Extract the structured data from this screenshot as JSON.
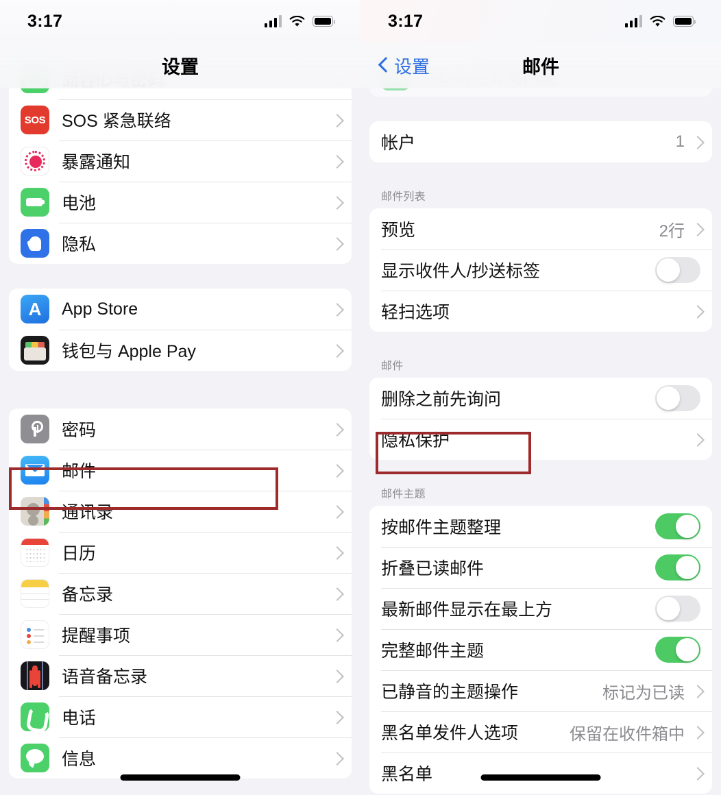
{
  "status_bar": {
    "time": "3:17",
    "cellular_icon": "signal-bars-icon",
    "wifi_icon": "wifi-icon",
    "battery_icon": "battery-full-icon"
  },
  "left_pane": {
    "nav": {
      "title": "设置"
    },
    "groups": [
      {
        "label": "",
        "rows": [
          {
            "label": "面容ID与密码",
            "icon": "faceid-icon",
            "accessory": "chevron"
          },
          {
            "label": "SOS 紧急联络",
            "icon": "sos-icon",
            "accessory": "chevron"
          },
          {
            "label": "暴露通知",
            "icon": "exposure-notification-icon",
            "accessory": "chevron"
          },
          {
            "label": "电池",
            "icon": "battery-icon",
            "accessory": "chevron"
          },
          {
            "label": "隐私",
            "icon": "privacy-hand-icon",
            "accessory": "chevron"
          }
        ]
      },
      {
        "label": "",
        "rows": [
          {
            "label": "App Store",
            "icon": "app-store-icon",
            "accessory": "chevron"
          },
          {
            "label": "钱包与 Apple Pay",
            "icon": "wallet-icon",
            "accessory": "chevron"
          }
        ]
      },
      {
        "label": "",
        "rows": [
          {
            "label": "密码",
            "icon": "passwords-key-icon",
            "accessory": "chevron"
          },
          {
            "label": "邮件",
            "icon": "mail-icon",
            "accessory": "chevron",
            "highlighted": true
          },
          {
            "label": "通讯录",
            "icon": "contacts-icon",
            "accessory": "chevron"
          },
          {
            "label": "日历",
            "icon": "calendar-icon",
            "accessory": "chevron"
          },
          {
            "label": "备忘录",
            "icon": "notes-icon",
            "accessory": "chevron"
          },
          {
            "label": "提醒事项",
            "icon": "reminders-icon",
            "accessory": "chevron"
          },
          {
            "label": "语音备忘录",
            "icon": "voice-memos-icon",
            "accessory": "chevron"
          },
          {
            "label": "电话",
            "icon": "phone-icon",
            "accessory": "chevron"
          },
          {
            "label": "信息",
            "icon": "messages-icon",
            "accessory": "chevron"
          }
        ]
      }
    ]
  },
  "right_pane": {
    "nav": {
      "back_label": "设置",
      "back_icon": "chevron-left-icon",
      "title": "邮件"
    },
    "clipped_row": {
      "label": "WLAN与蜂窝网络",
      "icon": "wlan-cellular-icon"
    },
    "groups": [
      {
        "label": "",
        "rows": [
          {
            "label": "帐户",
            "value": "1",
            "accessory": "chevron"
          }
        ]
      },
      {
        "label": "邮件列表",
        "rows": [
          {
            "label": "预览",
            "value": "2行",
            "accessory": "chevron"
          },
          {
            "label": "显示收件人/抄送标签",
            "accessory": "toggle",
            "toggle_state": "off"
          },
          {
            "label": "轻扫选项",
            "accessory": "chevron"
          }
        ]
      },
      {
        "label": "邮件",
        "rows": [
          {
            "label": "删除之前先询问",
            "accessory": "toggle",
            "toggle_state": "off"
          },
          {
            "label": "隐私保护",
            "accessory": "chevron",
            "highlighted": true
          }
        ]
      },
      {
        "label": "邮件主题",
        "rows": [
          {
            "label": "按邮件主题整理",
            "accessory": "toggle",
            "toggle_state": "on"
          },
          {
            "label": "折叠已读邮件",
            "accessory": "toggle",
            "toggle_state": "on"
          },
          {
            "label": "最新邮件显示在最上方",
            "accessory": "toggle",
            "toggle_state": "off"
          },
          {
            "label": "完整邮件主题",
            "accessory": "toggle",
            "toggle_state": "on"
          },
          {
            "label": "已静音的主题操作",
            "value": "标记为已读",
            "accessory": "chevron"
          },
          {
            "label": "黑名单发件人选项",
            "value": "保留在收件箱中",
            "accessory": "chevron"
          },
          {
            "label": "黑名单",
            "accessory": "chevron"
          }
        ]
      }
    ]
  },
  "colors": {
    "highlight_box": "#9e2b2b",
    "toggle_on": "#4dca64",
    "toggle_off": "#e6e6e9",
    "tint_blue": "#2f6fe0",
    "group_background": "#f2f2f7",
    "card_background": "#ffffff"
  }
}
